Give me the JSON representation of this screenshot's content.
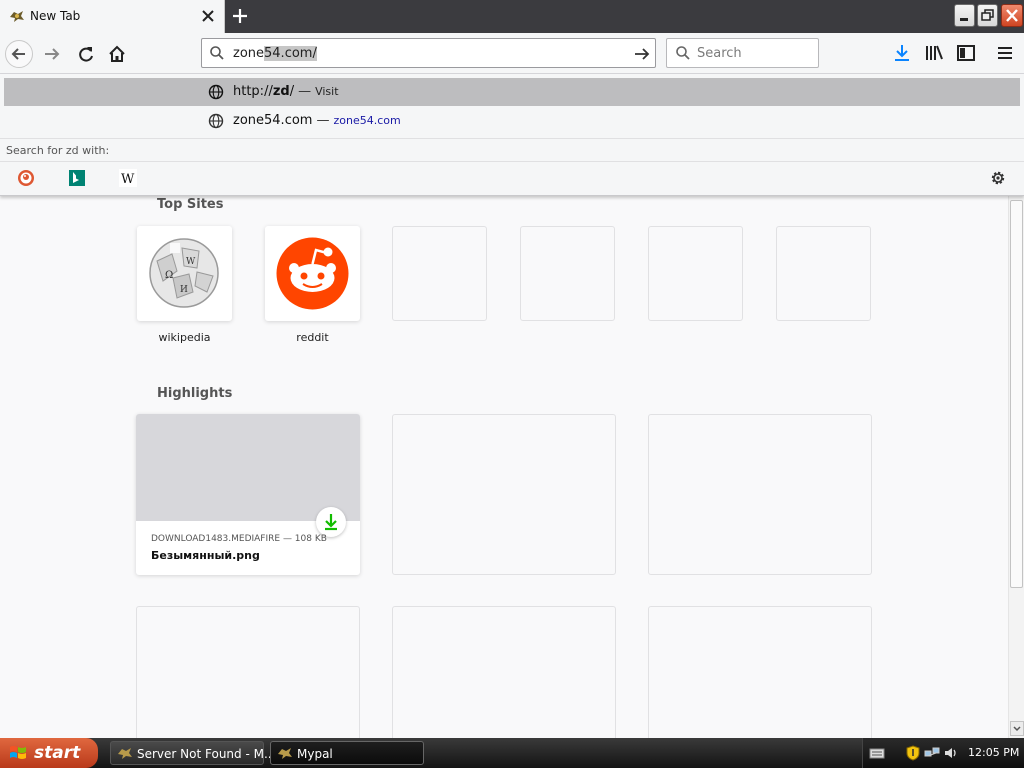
{
  "tab": {
    "title": "New Tab"
  },
  "urlbar": {
    "typed": "zone",
    "completed": "54.com/"
  },
  "searchbar": {
    "placeholder": "Search"
  },
  "autocomplete": {
    "rows": [
      {
        "title_prefix": "http://",
        "title_match": "zd",
        "title_suffix": "/",
        "sep": "—",
        "action": "Visit"
      },
      {
        "title": "zone54.com",
        "sep": "—",
        "url": "zone54.com"
      }
    ],
    "search_for": "Search for zd with:",
    "engines": [
      "duckduckgo-icon",
      "bing-icon",
      "wikipedia-icon"
    ]
  },
  "topsites": {
    "title": "Top Sites",
    "tiles": [
      {
        "label": "wikipedia",
        "icon": "wikipedia-globe-icon"
      },
      {
        "label": "reddit",
        "icon": "reddit-icon"
      }
    ]
  },
  "highlights": {
    "title": "Highlights",
    "cards": [
      {
        "meta": "DOWNLOAD1483.MEDIAFIRE — 108 KB",
        "name": "Безымянный.png"
      }
    ]
  },
  "taskbar": {
    "start": "start",
    "tasks": [
      {
        "label": "Server Not Found - M..."
      },
      {
        "label": "Mypal"
      }
    ],
    "clock": "12:05 PM"
  },
  "colors": {
    "accent": "#0a84ff",
    "reddit": "#ff4500",
    "start": "#c94a24",
    "download": "#12bc00"
  }
}
